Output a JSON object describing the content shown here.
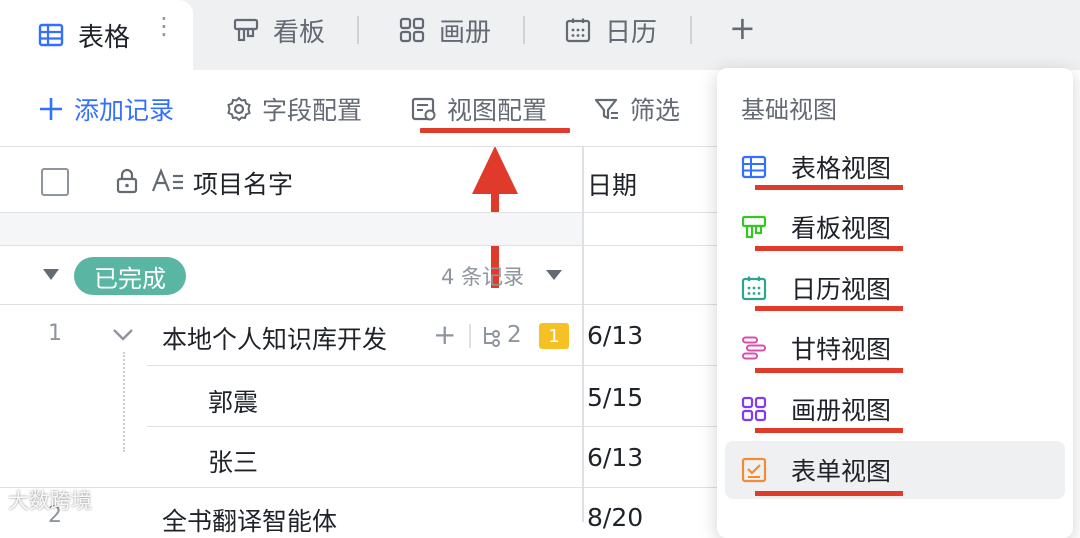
{
  "tabs": [
    {
      "label": "表格",
      "icon": "grid-table-icon",
      "active": true
    },
    {
      "label": "看板",
      "icon": "kanban-icon"
    },
    {
      "label": "画册",
      "icon": "gallery-icon"
    },
    {
      "label": "日历",
      "icon": "calendar-icon"
    }
  ],
  "tab_add": "+",
  "toolbar": {
    "add_record": "添加记录",
    "field_config": "字段配置",
    "view_config": "视图配置",
    "filter": "筛选"
  },
  "table": {
    "column_name": "项目名字",
    "column_date": "日期",
    "group": {
      "label": "已完成",
      "count_text": "4 条记录"
    },
    "rows": [
      {
        "index": "1",
        "name": "本地个人知识库开发",
        "subtask_count": "2",
        "badge": "1",
        "date": "6/13"
      },
      {
        "index": "",
        "name": "郭震",
        "date": "5/15"
      },
      {
        "index": "",
        "name": "张三",
        "date": "6/13"
      },
      {
        "index": "2",
        "name": "全书翻译智能体",
        "date": "8/20"
      }
    ]
  },
  "dropdown": {
    "section_title": "基础视图",
    "items": [
      {
        "label": "表格视图",
        "icon": "table-view-icon",
        "color": "#3370ff"
      },
      {
        "label": "看板视图",
        "icon": "kanban-view-icon",
        "color": "#34c724"
      },
      {
        "label": "日历视图",
        "icon": "calendar-view-icon",
        "color": "#2ea58e"
      },
      {
        "label": "甘特视图",
        "icon": "gantt-view-icon",
        "color": "#d94fb0"
      },
      {
        "label": "画册视图",
        "icon": "gallery-view-icon",
        "color": "#7f3bf5"
      },
      {
        "label": "表单视图",
        "icon": "form-view-icon",
        "color": "#f28b33"
      }
    ]
  },
  "annotation_color": "#e03a2b",
  "watermark": "大数跨境"
}
